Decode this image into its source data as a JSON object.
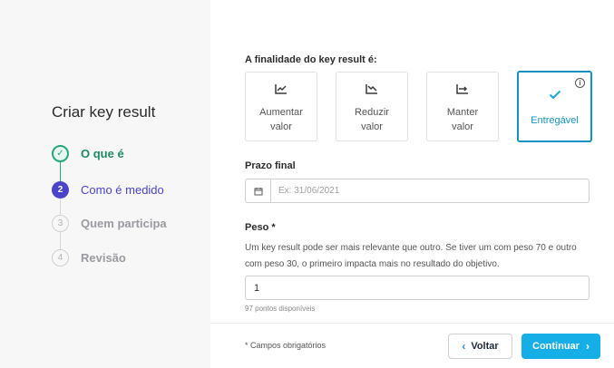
{
  "sidebar": {
    "title": "Criar key result",
    "steps": [
      {
        "number": "✓",
        "label": "O que é",
        "state": "done"
      },
      {
        "number": "2",
        "label": "Como é medido",
        "state": "current"
      },
      {
        "number": "3",
        "label": "Quem participa",
        "state": "todo"
      },
      {
        "number": "4",
        "label": "Revisão",
        "state": "todo"
      }
    ]
  },
  "purpose": {
    "label": "A finalidade do key result é:",
    "options": [
      {
        "icon": "trend-up-icon",
        "label": "Aumentar\nvalor"
      },
      {
        "icon": "trend-down-icon",
        "label": "Reduzir\nvalor"
      },
      {
        "icon": "trend-flat-icon",
        "label": "Manter\nvalor"
      },
      {
        "icon": "check-icon",
        "label": "Entregável",
        "selected": true
      }
    ]
  },
  "deadline": {
    "label": "Prazo final",
    "placeholder": "Ex: 31/06/2021",
    "value": ""
  },
  "weight": {
    "label": "Peso *",
    "description": "Um key result pode ser mais relevante que outro. Se tiver um com peso 70 e outro com peso 30, o primeiro impacta mais no resultado do objetivo.",
    "value": "1",
    "hint": "97 pontos disponíveis"
  },
  "footer": {
    "required_note": "* Campos obrigatórios",
    "back_label": "Voltar",
    "next_label": "Continuar"
  },
  "colors": {
    "accent": "#16aee6",
    "step_done": "#27a77a",
    "step_current": "#4b43c9"
  }
}
